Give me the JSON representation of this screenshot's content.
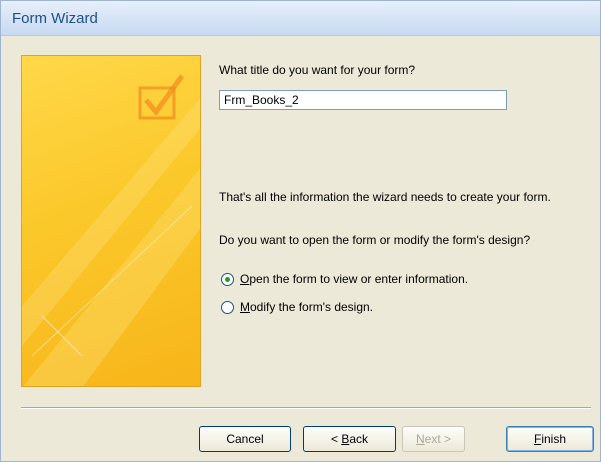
{
  "window": {
    "title": "Form Wizard"
  },
  "title_step": {
    "question": "What title do you want for your form?",
    "input_value": "Frm_Books_2"
  },
  "info_text": "That's all the information the wizard needs to create your form.",
  "open_question": "Do you want to open the form or modify the form's design?",
  "options": [
    {
      "accel": "O",
      "rest": "pen the form to view or enter information.",
      "checked": true
    },
    {
      "accel": "M",
      "rest": "odify the form's design.",
      "checked": false
    }
  ],
  "buttons": {
    "cancel": "Cancel",
    "back_prefix": "< ",
    "back_accel": "B",
    "back_rest": "ack",
    "next_accel": "N",
    "next_rest": "ext >",
    "finish_accel": "F",
    "finish_rest": "inish"
  },
  "colors": {
    "banner_yellow": "#fbc82a",
    "radio_checked": "#21a121",
    "title_text": "#1f4e8c"
  },
  "icons": {
    "banner": "checkbox-check-icon"
  }
}
